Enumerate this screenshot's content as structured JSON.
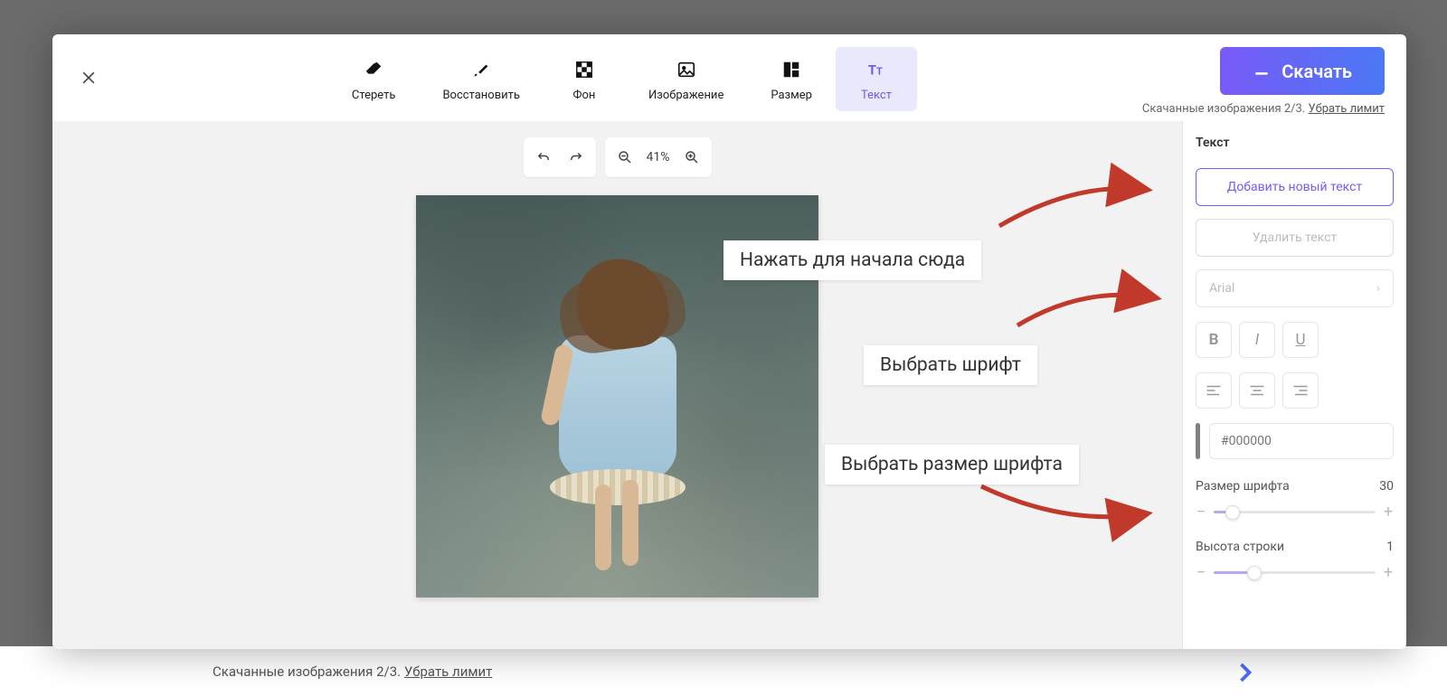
{
  "background": {
    "download_info_prefix": "Скачанные изображения ",
    "download_info_count": "2/3.",
    "remove_limit": "Убрать лимит"
  },
  "toolbar": {
    "erase": "Стереть",
    "restore": "Восстановить",
    "background": "Фон",
    "image": "Изображение",
    "size": "Размер",
    "text": "Текст"
  },
  "download": {
    "button": "Скачать",
    "info_prefix": "Скачанные изображения ",
    "info_count": "2/3.",
    "remove_limit": "Убрать лимит"
  },
  "canvas": {
    "zoom": "41%"
  },
  "sidepanel": {
    "title": "Текст",
    "add_text": "Добавить новый текст",
    "delete_text": "Удалить текст",
    "font": "Arial",
    "color_placeholder": "#000000",
    "font_size_label": "Размер шрифта",
    "font_size_value": "30",
    "line_height_label": "Высота строки",
    "line_height_value": "1"
  },
  "annotations": {
    "a1": "Нажать для начала сюда",
    "a2": "Выбрать шрифт",
    "a3": "Выбрать размер шрифта"
  }
}
